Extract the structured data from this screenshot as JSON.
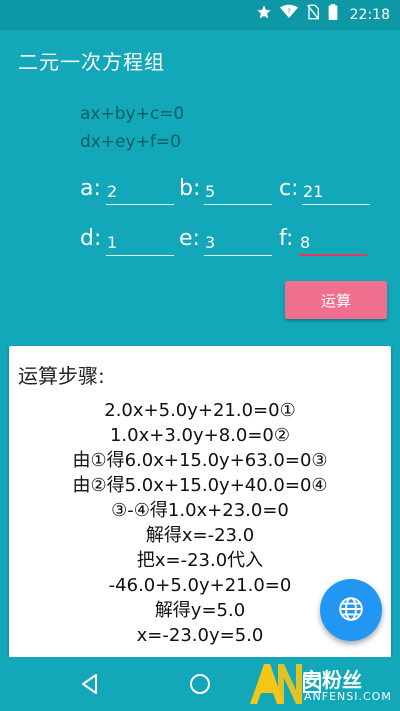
{
  "status_bar": {
    "time": "22:18",
    "icons": [
      "star-icon",
      "wifi-icon",
      "no-sim-icon",
      "battery-icon"
    ]
  },
  "app_bar": {
    "title": "二元一次方程组"
  },
  "form": {
    "formula_1": "ax+by+c=0",
    "formula_2": "dx+ey+f=0",
    "fields": [
      {
        "label": "a:",
        "value": "2"
      },
      {
        "label": "b:",
        "value": "5"
      },
      {
        "label": "c:",
        "value": "21"
      },
      {
        "label": "d:",
        "value": "1"
      },
      {
        "label": "e:",
        "value": "3"
      },
      {
        "label": "f:",
        "value": "8"
      }
    ],
    "button_label": "运算"
  },
  "result": {
    "title": "运算步骤:",
    "steps": [
      "2.0x+5.0y+21.0=0①",
      "1.0x+3.0y+8.0=0②",
      "由①得6.0x+15.0y+63.0=0③",
      "由②得5.0x+15.0y+40.0=0④",
      "③-④得1.0x+23.0=0",
      "解得x=-23.0",
      "把x=-23.0代入",
      "-46.0+5.0y+21.0=0",
      "解得y=5.0",
      "x=-23.0y=5.0"
    ]
  },
  "fab": {
    "icon": "globe-icon"
  },
  "nav_bar": {
    "icons": [
      "back-icon",
      "home-icon",
      "recents-icon"
    ]
  },
  "watermark": {
    "line_1": "安粉丝",
    "line_2": "ANFENSI.COM"
  },
  "colors": {
    "primary": "#12A8B9",
    "status_bar": "#0E97A5",
    "accent": "#F06E8E",
    "fab": "#2196F3",
    "focus_underline": "#E53958"
  }
}
